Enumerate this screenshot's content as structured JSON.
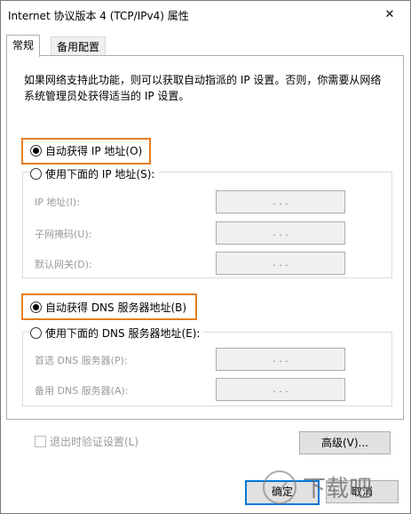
{
  "window": {
    "title": "Internet 协议版本 4 (TCP/IPv4) 属性",
    "close_glyph": "✕"
  },
  "tabs": [
    {
      "label": "常规",
      "active": true
    },
    {
      "label": "备用配置",
      "active": false
    }
  ],
  "description": "如果网络支持此功能，则可以获取自动指派的 IP 设置。否则，你需要从网络系统管理员处获得适当的 IP 设置。",
  "ip_section": {
    "auto_label": "自动获得 IP 地址(O)",
    "auto_selected": true,
    "manual_label": "使用下面的 IP 地址(S):",
    "manual_selected": false,
    "fields": [
      {
        "label": "IP 地址(I):",
        "value": ". . ."
      },
      {
        "label": "子网掩码(U):",
        "value": ". . ."
      },
      {
        "label": "默认网关(D):",
        "value": ". . ."
      }
    ]
  },
  "dns_section": {
    "auto_label": "自动获得 DNS 服务器地址(B)",
    "auto_selected": true,
    "manual_label": "使用下面的 DNS 服务器地址(E):",
    "manual_selected": false,
    "fields": [
      {
        "label": "首选 DNS 服务器(P):",
        "value": ". . ."
      },
      {
        "label": "备用 DNS 服务器(A):",
        "value": ". . ."
      }
    ]
  },
  "validate_on_exit": {
    "label": "退出时验证设置(L)",
    "checked": false,
    "enabled": false
  },
  "buttons": {
    "advanced": "高级(V)...",
    "ok": "确定",
    "cancel": "取消"
  },
  "colors": {
    "highlight": "#e67e22",
    "disabled_text": "#9a9a9a",
    "focus_border": "#0078d7"
  },
  "watermark": {
    "text": "下载吧"
  }
}
